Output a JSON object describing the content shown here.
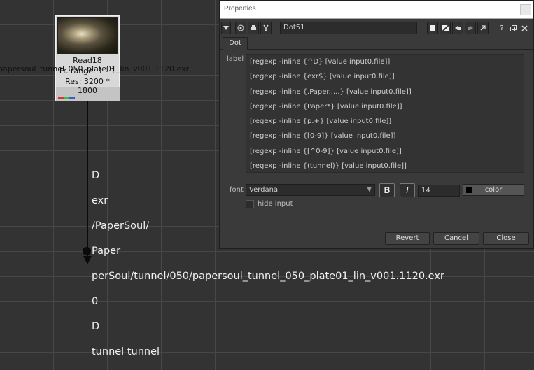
{
  "read_node": {
    "name": "Read18",
    "frame_range": "Fr. range: 1 - 1",
    "resolution": "Res: 3200 * 1800",
    "file": "papersoul_tunnel_050_plate01_lin_v001.1120.exr"
  },
  "dot_labels": [
    "D",
    "exr",
    "/PaperSoul/",
    "Paper",
    "perSoul/tunnel/050/papersoul_tunnel_050_plate01_lin_v001.1120.exr",
    "0",
    "D",
    "tunnel tunnel"
  ],
  "panel": {
    "title": "Properties",
    "node_name": "Dot51",
    "tab": "Dot",
    "label_field": "label",
    "label_lines": [
      "[regexp -inline {^D} [value input0.file]]",
      "[regexp -inline {exr$} [value input0.file]]",
      "[regexp -inline {.Paper.....} [value input0.file]]",
      "[regexp -inline {Paper*} [value input0.file]]",
      "[regexp -inline {p.+} [value input0.file]]",
      "[regexp -inline {[0-9]} [value input0.file]]",
      "[regexp -inline {[^0-9]} [value input0.file]]",
      "[regexp -inline {(tunnel)} [value input0.file]]"
    ],
    "font_label": "font",
    "font_value": "Verdana",
    "bold_label": "B",
    "italic_label": "I",
    "size_value": "14",
    "color_label": "color",
    "hide_input_label": "hide input",
    "buttons": {
      "revert": "Revert",
      "cancel": "Cancel",
      "close": "Close"
    }
  },
  "colors": {
    "background": "#333333",
    "panel": "#3a3a3a",
    "node": "#d8d8d8",
    "channel_red": "#d23a3a",
    "channel_green": "#3ac23a",
    "channel_blue": "#3a5ad2"
  }
}
